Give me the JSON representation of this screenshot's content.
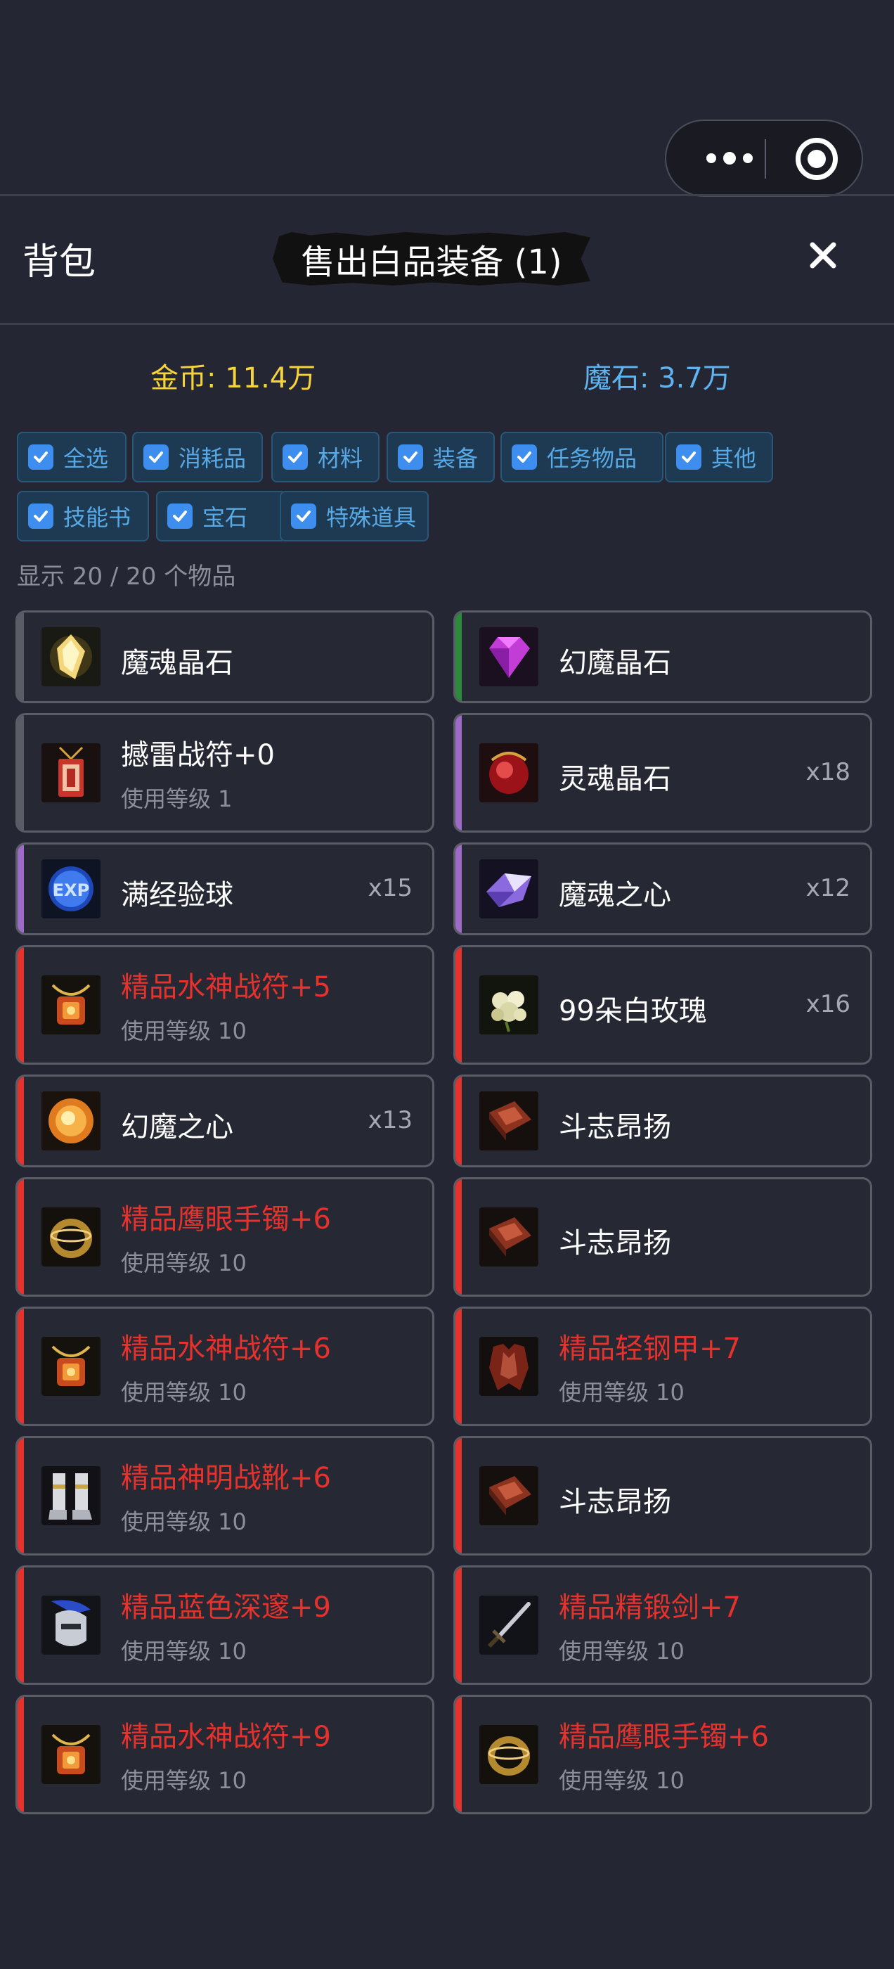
{
  "header": {
    "title": "背包",
    "banner": "售出白品装备 (1)",
    "close": "×"
  },
  "currency": {
    "gold": "金币: 11.4万",
    "stone": "魔石: 3.7万"
  },
  "filters": [
    "全选",
    "消耗品",
    "材料",
    "装备",
    "任务物品",
    "其他",
    "技能书",
    "宝石",
    "特殊道具"
  ],
  "count_text": "显示 20 / 20 个物品",
  "colors": {
    "red": "#e5322d",
    "purple": "#9d6bc7",
    "green": "#2c8a3c",
    "gray": "#5a5c66",
    "white": "#ffffff"
  },
  "items": [
    {
      "name": "魔魂晶石",
      "sub": "",
      "qty": "",
      "rarity": "gray",
      "icon": "gold-crystal-icon"
    },
    {
      "name": "幻魔晶石",
      "sub": "",
      "qty": "",
      "rarity": "green",
      "icon": "purple-gem-icon"
    },
    {
      "name": "撼雷战符+0",
      "sub": "使用等级 1",
      "qty": "",
      "rarity": "gray",
      "icon": "talisman-icon"
    },
    {
      "name": "灵魂晶石",
      "sub": "",
      "qty": "x18",
      "rarity": "purple",
      "icon": "red-soul-gem-icon"
    },
    {
      "name": "满经验球",
      "sub": "",
      "qty": "x15",
      "rarity": "purple",
      "icon": "exp-orb-icon"
    },
    {
      "name": "魔魂之心",
      "sub": "",
      "qty": "x12",
      "rarity": "purple",
      "icon": "violet-heart-crystal-icon"
    },
    {
      "name": "精品水神战符+5",
      "sub": "使用等级 10",
      "qty": "",
      "rarity": "red",
      "icon": "amulet-icon"
    },
    {
      "name": "99朵白玫瑰",
      "sub": "",
      "qty": "x16",
      "rarity": "red",
      "icon": "white-rose-icon"
    },
    {
      "name": "幻魔之心",
      "sub": "",
      "qty": "x13",
      "rarity": "red",
      "icon": "fire-orb-icon"
    },
    {
      "name": "斗志昂扬",
      "sub": "",
      "qty": "",
      "rarity": "red",
      "icon": "skill-book-icon"
    },
    {
      "name": "精品鹰眼手镯+6",
      "sub": "使用等级 10",
      "qty": "",
      "rarity": "red",
      "icon": "bracelet-icon"
    },
    {
      "name": "斗志昂扬",
      "sub": "",
      "qty": "",
      "rarity": "red",
      "icon": "skill-book-icon"
    },
    {
      "name": "精品水神战符+6",
      "sub": "使用等级 10",
      "qty": "",
      "rarity": "red",
      "icon": "amulet-icon"
    },
    {
      "name": "精品轻钢甲+7",
      "sub": "使用等级 10",
      "qty": "",
      "rarity": "red",
      "icon": "armor-icon"
    },
    {
      "name": "精品神明战靴+6",
      "sub": "使用等级 10",
      "qty": "",
      "rarity": "red",
      "icon": "boots-icon"
    },
    {
      "name": "斗志昂扬",
      "sub": "",
      "qty": "",
      "rarity": "red",
      "icon": "skill-book-icon"
    },
    {
      "name": "精品蓝色深邃+9",
      "sub": "使用等级 10",
      "qty": "",
      "rarity": "red",
      "icon": "helmet-icon"
    },
    {
      "name": "精品精锻剑+7",
      "sub": "使用等级 10",
      "qty": "",
      "rarity": "red",
      "icon": "sword-icon"
    },
    {
      "name": "精品水神战符+9",
      "sub": "使用等级 10",
      "qty": "",
      "rarity": "red",
      "icon": "amulet-icon"
    },
    {
      "name": "精品鹰眼手镯+6",
      "sub": "使用等级 10",
      "qty": "",
      "rarity": "red",
      "icon": "bracelet-icon"
    }
  ]
}
